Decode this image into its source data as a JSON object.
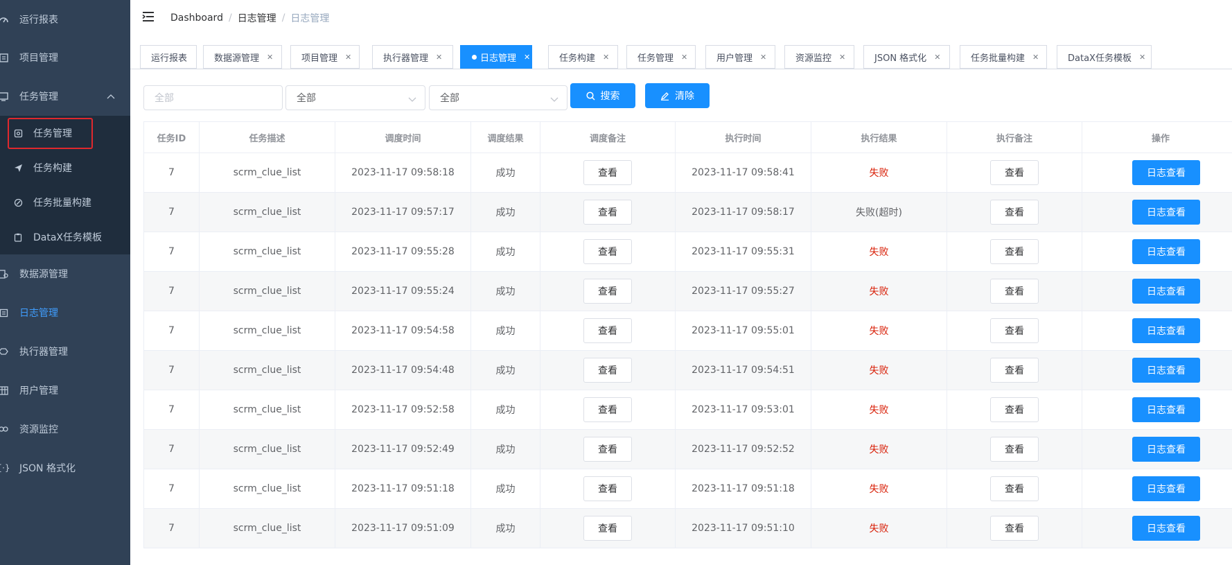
{
  "sidebar": {
    "items": [
      {
        "label": "运行报表",
        "icon": "dashboard-icon"
      },
      {
        "label": "项目管理",
        "icon": "project-icon"
      },
      {
        "label": "任务管理",
        "icon": "task-icon",
        "expanded": true,
        "children": [
          {
            "label": "任务管理",
            "icon": "task-list-icon",
            "highlighted": true
          },
          {
            "label": "任务构建",
            "icon": "send-icon"
          },
          {
            "label": "任务批量构建",
            "icon": "batch-icon"
          },
          {
            "label": "DataX任务模板",
            "icon": "clipboard-icon"
          }
        ]
      },
      {
        "label": "数据源管理",
        "icon": "datasource-icon"
      },
      {
        "label": "日志管理",
        "icon": "log-icon",
        "active": true
      },
      {
        "label": "执行器管理",
        "icon": "executor-icon"
      },
      {
        "label": "用户管理",
        "icon": "user-table-icon"
      },
      {
        "label": "资源监控",
        "icon": "monitor-icon"
      },
      {
        "label": "JSON 格式化",
        "icon": "json-icon"
      }
    ]
  },
  "breadcrumb": [
    "Dashboard",
    "日志管理",
    "日志管理"
  ],
  "tabs": [
    {
      "label": "运行报表",
      "closable": false
    },
    {
      "label": "数据源管理",
      "closable": true
    },
    {
      "label": "项目管理",
      "closable": true
    },
    {
      "label": "执行器管理",
      "closable": true
    },
    {
      "label": "日志管理",
      "closable": true,
      "active": true
    },
    {
      "label": "任务构建",
      "closable": true
    },
    {
      "label": "任务管理",
      "closable": true
    },
    {
      "label": "用户管理",
      "closable": true
    },
    {
      "label": "资源监控",
      "closable": true
    },
    {
      "label": "JSON 格式化",
      "closable": true
    },
    {
      "label": "任务批量构建",
      "closable": true
    },
    {
      "label": "DataX任务模板",
      "closable": true
    }
  ],
  "filters": {
    "input_placeholder": "全部",
    "select1_value": "全部",
    "select2_value": "全部",
    "search_label": "搜索",
    "clear_label": "清除"
  },
  "table": {
    "columns": [
      "任务ID",
      "任务描述",
      "调度时间",
      "调度结果",
      "调度备注",
      "执行时间",
      "执行结果",
      "执行备注",
      "操作"
    ],
    "view_label": "查看",
    "log_label": "日志查看",
    "rows": [
      {
        "id": "7",
        "desc": "scrm_clue_list",
        "trigger_time": "2023-11-17 09:58:18",
        "trigger_result": "成功",
        "exec_time": "2023-11-17 09:58:41",
        "exec_result": "失败",
        "failed": true
      },
      {
        "id": "7",
        "desc": "scrm_clue_list",
        "trigger_time": "2023-11-17 09:57:17",
        "trigger_result": "成功",
        "exec_time": "2023-11-17 09:58:17",
        "exec_result": "失败(超时)",
        "failed": false
      },
      {
        "id": "7",
        "desc": "scrm_clue_list",
        "trigger_time": "2023-11-17 09:55:28",
        "trigger_result": "成功",
        "exec_time": "2023-11-17 09:55:31",
        "exec_result": "失败",
        "failed": true
      },
      {
        "id": "7",
        "desc": "scrm_clue_list",
        "trigger_time": "2023-11-17 09:55:24",
        "trigger_result": "成功",
        "exec_time": "2023-11-17 09:55:27",
        "exec_result": "失败",
        "failed": true
      },
      {
        "id": "7",
        "desc": "scrm_clue_list",
        "trigger_time": "2023-11-17 09:54:58",
        "trigger_result": "成功",
        "exec_time": "2023-11-17 09:55:01",
        "exec_result": "失败",
        "failed": true
      },
      {
        "id": "7",
        "desc": "scrm_clue_list",
        "trigger_time": "2023-11-17 09:54:48",
        "trigger_result": "成功",
        "exec_time": "2023-11-17 09:54:51",
        "exec_result": "失败",
        "failed": true
      },
      {
        "id": "7",
        "desc": "scrm_clue_list",
        "trigger_time": "2023-11-17 09:52:58",
        "trigger_result": "成功",
        "exec_time": "2023-11-17 09:53:01",
        "exec_result": "失败",
        "failed": true
      },
      {
        "id": "7",
        "desc": "scrm_clue_list",
        "trigger_time": "2023-11-17 09:52:49",
        "trigger_result": "成功",
        "exec_time": "2023-11-17 09:52:52",
        "exec_result": "失败",
        "failed": true
      },
      {
        "id": "7",
        "desc": "scrm_clue_list",
        "trigger_time": "2023-11-17 09:51:18",
        "trigger_result": "成功",
        "exec_time": "2023-11-17 09:51:18",
        "exec_result": "失败",
        "failed": true
      },
      {
        "id": "7",
        "desc": "scrm_clue_list",
        "trigger_time": "2023-11-17 09:51:09",
        "trigger_result": "成功",
        "exec_time": "2023-11-17 09:51:10",
        "exec_result": "失败",
        "failed": true
      }
    ]
  },
  "colors": {
    "sidebar_bg": "#304156",
    "submenu_bg": "#1f2d3d",
    "primary": "#1890ff",
    "active_text": "#409eff",
    "fail_text": "#d81e06",
    "highlight_border": "#e0282d"
  }
}
